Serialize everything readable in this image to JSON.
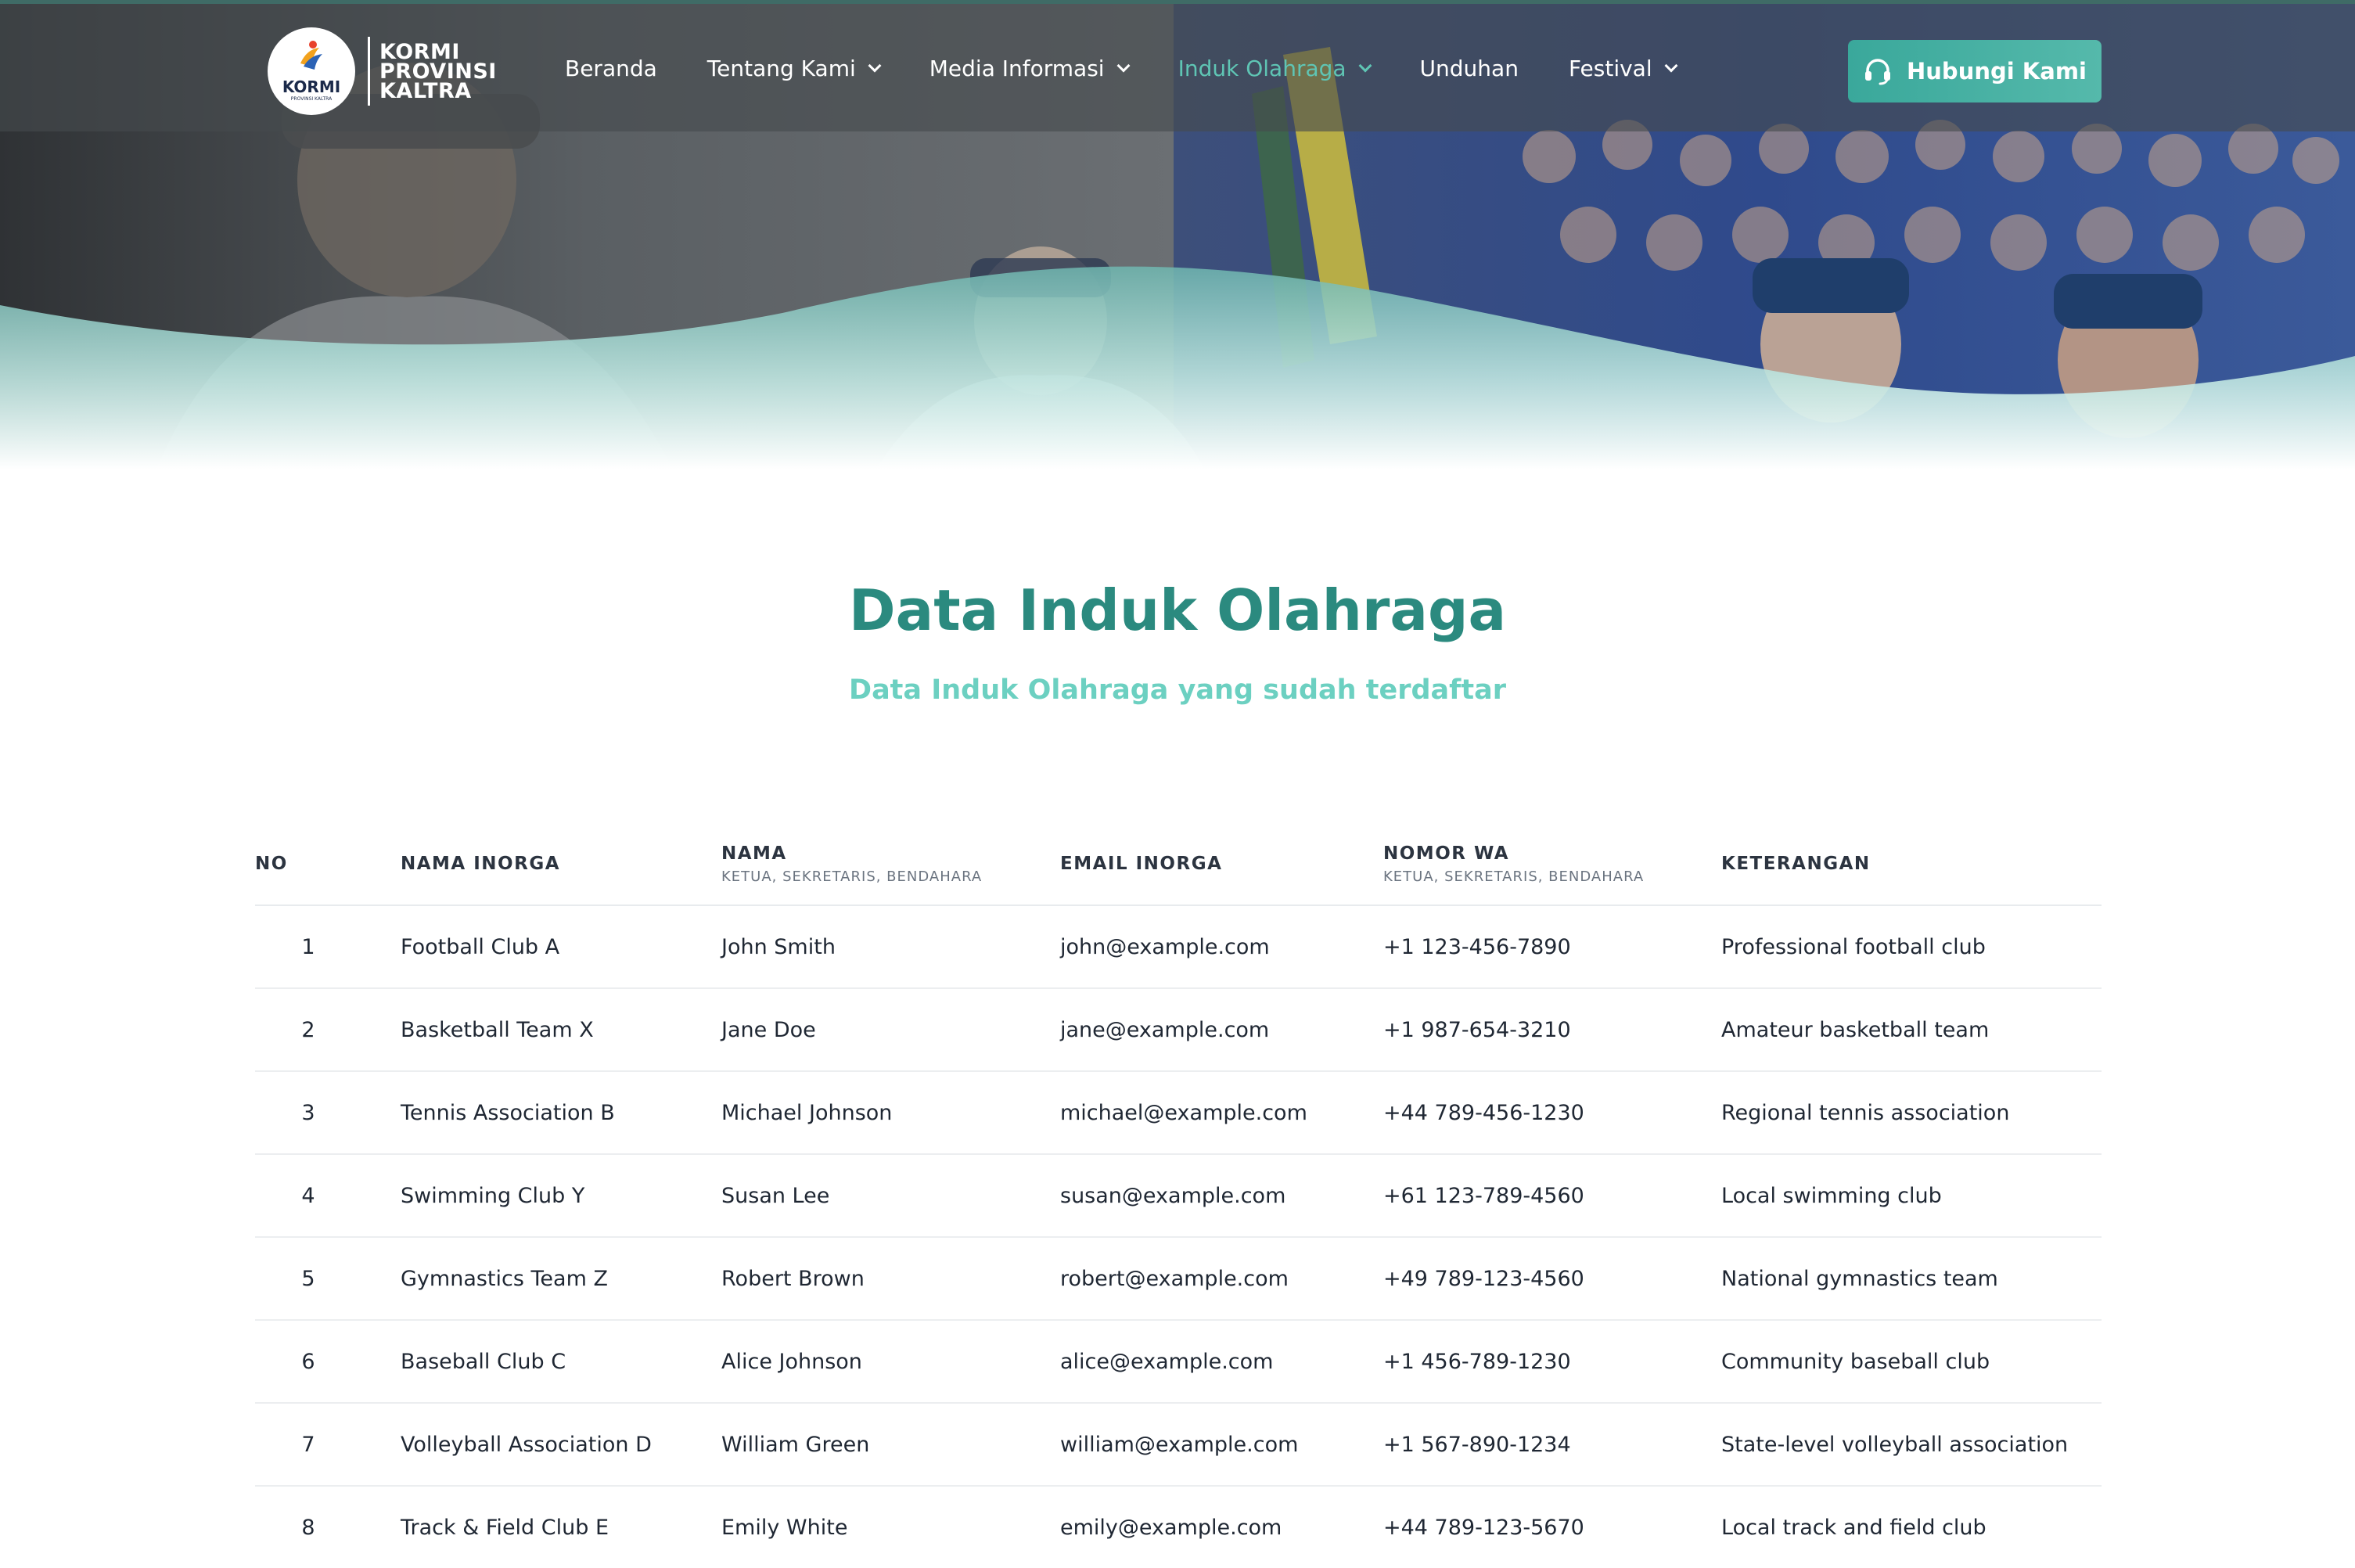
{
  "brand": {
    "logo_word": "KORMI",
    "logo_tiny": "PROVINSI KALTRA",
    "line1": "KORMI",
    "line2": "PROVINSI",
    "line3": "KALTRA"
  },
  "nav": {
    "items": [
      {
        "label": "Beranda",
        "has_dropdown": false,
        "active": false
      },
      {
        "label": "Tentang Kami",
        "has_dropdown": true,
        "active": false
      },
      {
        "label": "Media Informasi",
        "has_dropdown": true,
        "active": false
      },
      {
        "label": "Induk Olahraga",
        "has_dropdown": true,
        "active": true
      },
      {
        "label": "Unduhan",
        "has_dropdown": false,
        "active": false
      },
      {
        "label": "Festival",
        "has_dropdown": true,
        "active": false
      }
    ],
    "cta_label": "Hubungi Kami"
  },
  "section": {
    "title": "Data Induk Olahraga",
    "subtitle": "Data Induk Olahraga yang sudah terdaftar"
  },
  "table": {
    "columns": [
      {
        "title": "NO",
        "sub": ""
      },
      {
        "title": "NAMA INORGA",
        "sub": ""
      },
      {
        "title": "NAMA",
        "sub": "KETUA, SEKRETARIS, BENDAHARA"
      },
      {
        "title": "EMAIL INORGA",
        "sub": ""
      },
      {
        "title": "NOMOR WA",
        "sub": "KETUA, SEKRETARIS, BENDAHARA"
      },
      {
        "title": "KETERANGAN",
        "sub": ""
      }
    ],
    "rows": [
      {
        "no": "1",
        "inorga": "Football Club A",
        "nama": "John Smith",
        "email": "john@example.com",
        "wa": "+1 123-456-7890",
        "ket": "Professional football club"
      },
      {
        "no": "2",
        "inorga": "Basketball Team X",
        "nama": "Jane Doe",
        "email": "jane@example.com",
        "wa": "+1 987-654-3210",
        "ket": "Amateur basketball team"
      },
      {
        "no": "3",
        "inorga": "Tennis Association B",
        "nama": "Michael Johnson",
        "email": "michael@example.com",
        "wa": "+44 789-456-1230",
        "ket": "Regional tennis association"
      },
      {
        "no": "4",
        "inorga": "Swimming Club Y",
        "nama": "Susan Lee",
        "email": "susan@example.com",
        "wa": "+61 123-789-4560",
        "ket": "Local swimming club"
      },
      {
        "no": "5",
        "inorga": "Gymnastics Team Z",
        "nama": "Robert Brown",
        "email": "robert@example.com",
        "wa": "+49 789-123-4560",
        "ket": "National gymnastics team"
      },
      {
        "no": "6",
        "inorga": "Baseball Club C",
        "nama": "Alice Johnson",
        "email": "alice@example.com",
        "wa": "+1 456-789-1230",
        "ket": "Community baseball club"
      },
      {
        "no": "7",
        "inorga": "Volleyball Association D",
        "nama": "William Green",
        "email": "william@example.com",
        "wa": "+1 567-890-1234",
        "ket": "State-level volleyball association"
      },
      {
        "no": "8",
        "inorga": "Track & Field Club E",
        "nama": "Emily White",
        "email": "emily@example.com",
        "wa": "+44 789-123-5670",
        "ket": "Local track and field club"
      }
    ]
  },
  "colors": {
    "accent": "#2b8a7f",
    "accent_light": "#6cd0c1",
    "nav_active": "#5fc5b4",
    "cta": "#3aa89b"
  },
  "icons": {
    "cta_icon": "headset-icon",
    "dropdown_icon": "chevron-down-icon"
  }
}
